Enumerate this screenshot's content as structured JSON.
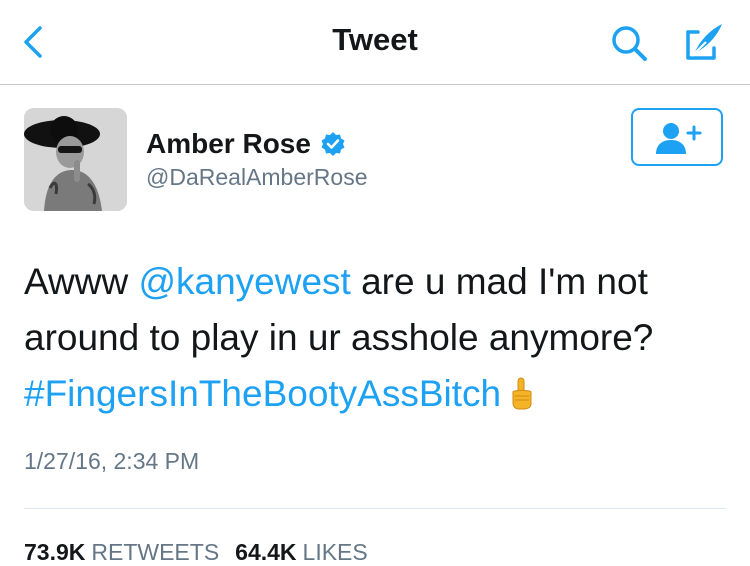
{
  "nav": {
    "title": "Tweet",
    "back_icon": "chevron-left-icon",
    "search_icon": "search-icon",
    "compose_icon": "compose-icon",
    "accent_color": "#1da1f2"
  },
  "user": {
    "display_name": "Amber Rose",
    "handle": "@DaRealAmberRose",
    "verified": true,
    "follow_icon": "add-user-icon"
  },
  "tweet": {
    "text_part1": "Awww ",
    "mention": "@kanyewest",
    "text_part2": " are u mad I'm not around to play in ur asshole anymore? ",
    "hashtag": "#FingersInTheBootyAssBitch",
    "emoji": "pointing-up-hand-icon",
    "timestamp": "1/27/16, 2:34 PM"
  },
  "stats": {
    "retweets_count": "73.9K",
    "retweets_label": "RETWEETS",
    "likes_count": "64.4K",
    "likes_label": "LIKES"
  }
}
